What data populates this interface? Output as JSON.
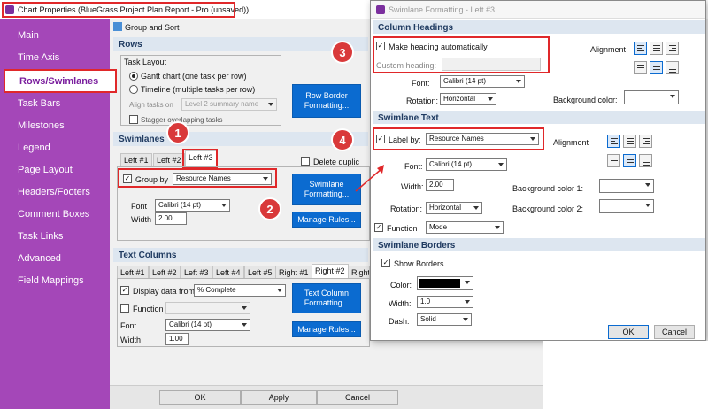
{
  "window": {
    "title": "Chart Properties (BlueGrass Project Plan Report - Pro (unsaved))"
  },
  "sidebar": {
    "items": [
      {
        "label": "Main"
      },
      {
        "label": "Time Axis"
      },
      {
        "label": "Rows/Swimlanes"
      },
      {
        "label": "Task Bars"
      },
      {
        "label": "Milestones"
      },
      {
        "label": "Legend"
      },
      {
        "label": "Page Layout"
      },
      {
        "label": "Headers/Footers"
      },
      {
        "label": "Comment Boxes"
      },
      {
        "label": "Task Links"
      },
      {
        "label": "Advanced"
      },
      {
        "label": "Field Mappings"
      }
    ]
  },
  "toolbar": {
    "group_sort": "Group and Sort"
  },
  "rows": {
    "header": "Rows",
    "task_layout_label": "Task Layout",
    "gantt_option": "Gantt chart (one task per row)",
    "timeline_option": "Timeline (multiple tasks per row)",
    "align_tasks_label": "Align tasks on",
    "align_tasks_value": "Level 2 summary name",
    "stagger_label": "Stagger overlapping tasks",
    "row_border_btn": "Row Border Formatting..."
  },
  "swimlanes": {
    "header": "Swimlanes",
    "tabs": [
      "Left #1",
      "Left #2",
      "Left #3"
    ],
    "delete_label": "Delete duplic",
    "group_by_label": "Group by",
    "group_by_value": "Resource Names",
    "font_label": "Font",
    "font_value": "Calibri (14 pt)",
    "width_label": "Width",
    "width_value": "2.00",
    "swimlane_btn": "Swimlane Formatting...",
    "manage_rules_btn": "Manage Rules..."
  },
  "text_columns": {
    "header": "Text Columns",
    "tabs": [
      "Left #1",
      "Left #2",
      "Left #3",
      "Left #4",
      "Left #5",
      "Right #1",
      "Right #2",
      "Right"
    ],
    "display_label": "Display data from",
    "display_value": "% Complete",
    "function_label": "Function",
    "font_label": "Font",
    "font_value": "Calibri (14 pt)",
    "width_label": "Width",
    "width_value": "1.00",
    "text_col_btn": "Text Column Formatting...",
    "manage_rules_btn": "Manage Rules..."
  },
  "footer": {
    "ok": "OK",
    "apply": "Apply",
    "cancel": "Cancel"
  },
  "dialog": {
    "title": "Swimlane Formatting - Left #3",
    "column_headings": {
      "header": "Column Headings",
      "make_heading_label": "Make heading automatically",
      "custom_heading_label": "Custom heading:",
      "font_label": "Font:",
      "font_value": "Calibri (14 pt)",
      "rotation_label": "Rotation:",
      "rotation_value": "Horizontal",
      "alignment_label": "Alignment",
      "bg_label": "Background color:"
    },
    "swimlane_text": {
      "header": "Swimlane Text",
      "label_by_label": "Label by:",
      "label_by_value": "Resource Names",
      "alignment_label": "Alignment",
      "font_label": "Font:",
      "font_value": "Calibri (14 pt)",
      "width_label": "Width:",
      "width_value": "2.00",
      "rotation_label": "Rotation:",
      "rotation_value": "Horizontal",
      "bg1_label": "Background color 1:",
      "bg2_label": "Background color 2:",
      "function_label": "Function",
      "function_value": "Mode"
    },
    "swimlane_borders": {
      "header": "Swimlane Borders",
      "show_borders_label": "Show Borders",
      "color_label": "Color:",
      "width_label": "Width:",
      "width_value": "1.0",
      "dash_label": "Dash:",
      "dash_value": "Solid"
    },
    "ok": "OK",
    "cancel": "Cancel"
  },
  "badges": [
    "1",
    "2",
    "3",
    "4"
  ],
  "colors": {
    "sidebar": "#a447b8",
    "accent_blue": "#0b6bd0",
    "annotation_red": "#e0282a"
  }
}
